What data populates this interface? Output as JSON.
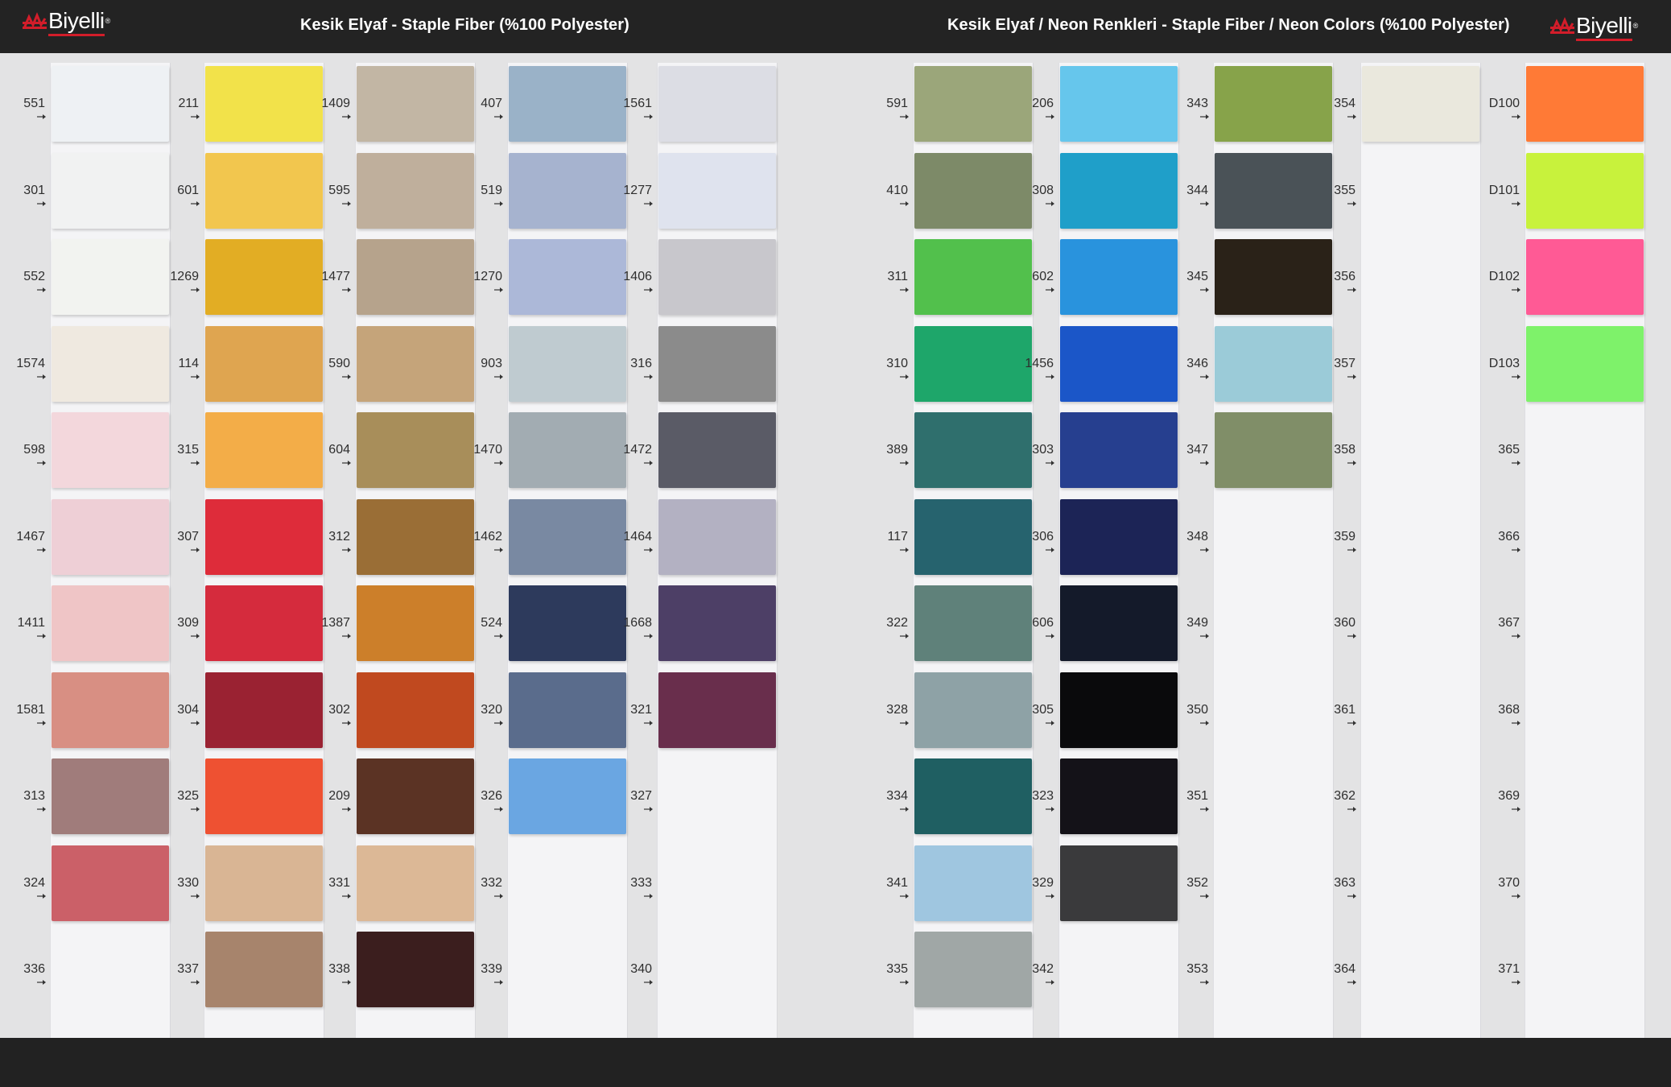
{
  "header": {
    "brand_name": "Biyelli",
    "brand_mark": "®",
    "title_left": "Kesik Elyaf - Staple Fiber (%100 Polyester)",
    "title_right": "Kesik Elyaf / Neon Renkleri - Staple Fiber / Neon Colors (%100 Polyester)",
    "logo_icon": "biyelli-logo-icon",
    "brand_color": "#d21d2a"
  },
  "panels": [
    {
      "name": "staple-fiber",
      "columns": [
        {
          "codes": [
            "551",
            "301",
            "552",
            "1574",
            "598",
            "1467",
            "1411",
            "1581",
            "313",
            "324",
            "336"
          ],
          "colors": [
            "#eef1f4",
            "#f1f2f2",
            "#f2f3f0",
            "#efe9e0",
            "#f3d7dc",
            "#eecfd6",
            "#efc5c6",
            "#d88f83",
            "#a07c7b",
            "#cb6068",
            null
          ]
        },
        {
          "codes": [
            "211",
            "601",
            "1269",
            "114",
            "315",
            "307",
            "309",
            "304",
            "325",
            "330",
            "337"
          ],
          "colors": [
            "#f2e24a",
            "#f2c64e",
            "#e2ad24",
            "#dfa550",
            "#f3ad48",
            "#de2c3a",
            "#d52b3d",
            "#9a2232",
            "#ee5132",
            "#d9b594",
            "#a7846c"
          ]
        },
        {
          "codes": [
            "1409",
            "595",
            "1477",
            "590",
            "604",
            "312",
            "1387",
            "302",
            "209",
            "331",
            "338"
          ],
          "colors": [
            "#c2b6a4",
            "#bfaf9c",
            "#b6a38c",
            "#c5a47a",
            "#a88e5a",
            "#9a6e36",
            "#cc7f2a",
            "#c0491f",
            "#5b3324",
            "#dcb896",
            "#3b1e1e"
          ]
        },
        {
          "codes": [
            "407",
            "519",
            "1270",
            "903",
            "1470",
            "1462",
            "524",
            "320",
            "326",
            "332",
            "339"
          ],
          "colors": [
            "#9ab2c8",
            "#a6b3cf",
            "#acb8d8",
            "#bfcbd0",
            "#a2acb2",
            "#7989a2",
            "#2d3a5c",
            "#5a6c8c",
            "#6aa6e2",
            null,
            null
          ]
        },
        {
          "codes": [
            "1561",
            "1277",
            "1406",
            "316",
            "1472",
            "1464",
            "1668",
            "321",
            "327",
            "333",
            "340"
          ],
          "colors": [
            "#dcdde4",
            "#dfe3ee",
            "#c8c7cc",
            "#8b8b8b",
            "#5a5b66",
            "#b3b1c2",
            "#4d3f66",
            "#692e4c",
            null,
            null,
            null
          ]
        }
      ]
    },
    {
      "name": "neon-colors",
      "columns": [
        {
          "codes": [
            "591",
            "410",
            "311",
            "310",
            "389",
            "117",
            "322",
            "328",
            "334",
            "341",
            "335"
          ],
          "colors": [
            "#9ba67a",
            "#7d8a68",
            "#52c04c",
            "#1ea66a",
            "#2f6f6d",
            "#26636e",
            "#5f817a",
            "#8ea2a6",
            "#1f5f62",
            "#9fc6e0",
            "#a0a7a6"
          ]
        },
        {
          "codes": [
            "206",
            "308",
            "602",
            "1456",
            "303",
            "306",
            "606",
            "305",
            "323",
            "329",
            "342"
          ],
          "colors": [
            "#66c6ec",
            "#1f9fc9",
            "#2993dd",
            "#1b56c8",
            "#263f8f",
            "#1c2456",
            "#141a2a",
            "#0a0a0c",
            "#141218",
            "#3a3a3c",
            null
          ]
        },
        {
          "codes": [
            "343",
            "344",
            "345",
            "346",
            "347",
            "348",
            "349",
            "350",
            "351",
            "352",
            "353"
          ],
          "colors": [
            "#87a34a",
            "#4a5257",
            "#2a2218",
            "#9bcbd8",
            "#808e68",
            null,
            null,
            null,
            null,
            null,
            null
          ]
        },
        {
          "codes": [
            "354",
            "355",
            "356",
            "357",
            "358",
            "359",
            "360",
            "361",
            "362",
            "363",
            "364"
          ],
          "colors": [
            "#eae8dd",
            null,
            null,
            null,
            null,
            null,
            null,
            null,
            null,
            null,
            null
          ]
        },
        {
          "codes": [
            "D100",
            "D101",
            "D102",
            "D103",
            "365",
            "366",
            "367",
            "368",
            "369",
            "370",
            "371"
          ],
          "colors": [
            "#ff7a36",
            "#c8f23c",
            "#ff5a95",
            "#7ef26a",
            null,
            null,
            null,
            null,
            null,
            null,
            null
          ]
        }
      ]
    }
  ]
}
